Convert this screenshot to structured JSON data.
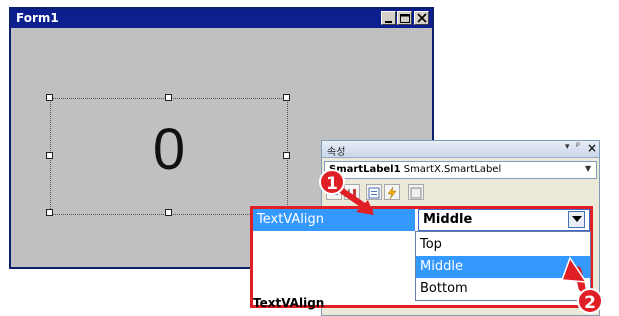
{
  "form_window": {
    "title": "Form1",
    "label_value": "0"
  },
  "properties_panel": {
    "title": "속성",
    "pin_glyph": "▾",
    "pushpin_glyph": "ᵖ",
    "close_glyph": "×",
    "object_selector": {
      "name": "SmartLabel1",
      "type": "SmartX.SmartLabel"
    },
    "toolbar_icons": [
      "categorized-icon",
      "alphabetical-icon",
      "properties-icon",
      "events-icon",
      "property-pages-icon"
    ]
  },
  "highlight": {
    "property_name": "TextVAlign",
    "property_value": "Middle",
    "options": [
      "Top",
      "Middle",
      "Bottom"
    ],
    "selected_option": "Middle",
    "description_name": "TextVAlign"
  },
  "callouts": [
    "1",
    "2"
  ],
  "colors": {
    "accent_red": "#e01e26",
    "selection_blue": "#3399ff",
    "titlebar_navy": "#0d1e8f"
  }
}
